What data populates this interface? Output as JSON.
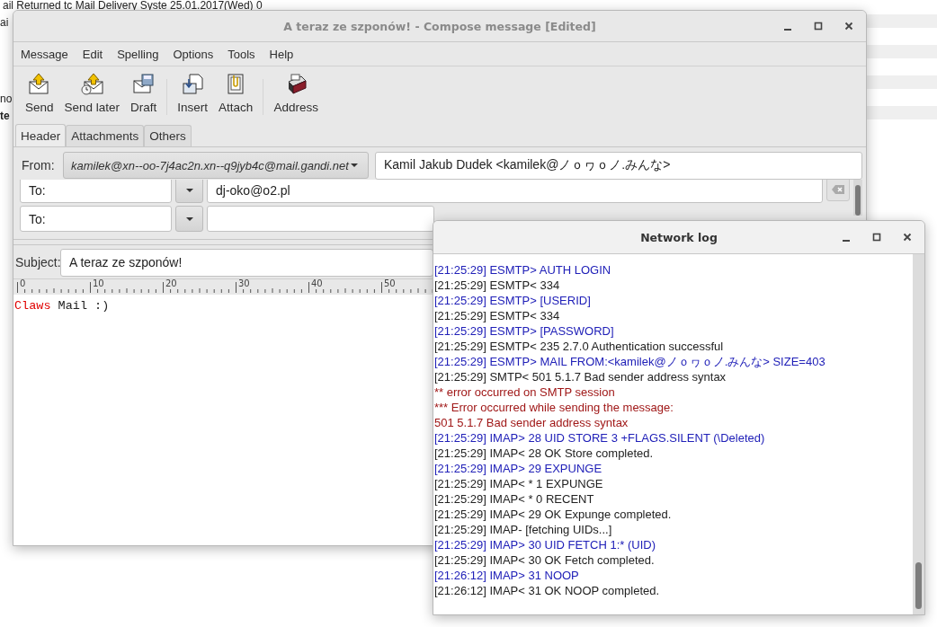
{
  "background_window": {
    "rows": [
      {
        "text": "ail Returned tc Mail Delivery Syste 25.01.2017(Wed) 0",
        "bold": false
      },
      {
        "text": "ai",
        "bold": false
      },
      {
        "text": "no",
        "bold": false
      },
      {
        "text": "te",
        "bold": true
      }
    ]
  },
  "compose_window": {
    "title": "A teraz ze szponów! - Compose message [Edited]",
    "menu": [
      "Message",
      "Edit",
      "Spelling",
      "Options",
      "Tools",
      "Help"
    ],
    "toolbar": [
      [
        {
          "label": "Send",
          "kind": "send"
        },
        {
          "label": "Send later",
          "kind": "send_later"
        },
        {
          "label": "Draft",
          "kind": "draft"
        }
      ],
      [
        {
          "label": "Insert",
          "kind": "insert"
        },
        {
          "label": "Attach",
          "kind": "attach"
        }
      ],
      [
        {
          "label": "Address",
          "kind": "address"
        }
      ]
    ],
    "tabs": [
      {
        "label": "Header",
        "selected": true
      },
      {
        "label": "Attachments",
        "selected": false
      },
      {
        "label": "Others",
        "selected": false
      }
    ],
    "from": {
      "label": "From:",
      "account": "kamilek@xn--oo-7j4ac2n.xn--q9jyb4c@mail.gandi.net",
      "name": "Kamil Jakub Dudek <kamilek@ノｏヮｏノ.みんな>"
    },
    "recipients": [
      {
        "type": "To:",
        "address": "dj-oko@o2.pl"
      },
      {
        "type": "To:"
      }
    ],
    "subject": {
      "label": "Subject:",
      "value": "A teraz ze szponów!"
    },
    "ruler": [
      "0",
      "10",
      "20",
      "30",
      "40",
      "50"
    ],
    "body": [
      {
        "text": "Claws",
        "kind": "highlight"
      },
      {
        "text": " Mail :)",
        "kind": "plain"
      }
    ]
  },
  "network_log": {
    "title": "Network log",
    "lines": [
      {
        "text": "[21:25:29] ESMTP> AUTH LOGIN",
        "kind": "out"
      },
      {
        "text": "[21:25:29] ESMTP< 334",
        "kind": "in"
      },
      {
        "text": "[21:25:29] ESMTP> [USERID]",
        "kind": "out"
      },
      {
        "text": "[21:25:29] ESMTP< 334",
        "kind": "in"
      },
      {
        "text": "[21:25:29] ESMTP> [PASSWORD]",
        "kind": "out"
      },
      {
        "text": "[21:25:29] ESMTP< 235 2.7.0 Authentication successful",
        "kind": "in"
      },
      {
        "text": "[21:25:29] ESMTP> MAIL FROM:<kamilek@ノｏヮｏノ.みんな> SIZE=403",
        "kind": "out"
      },
      {
        "text": "[21:25:29] SMTP< 501 5.1.7 Bad sender address syntax",
        "kind": "in"
      },
      {
        "text": "** error occurred on SMTP session",
        "kind": "error"
      },
      {
        "text": "*** Error occurred while sending the message:",
        "kind": "error"
      },
      {
        "text": "501 5.1.7 Bad sender address syntax",
        "kind": "error"
      },
      {
        "text": "[21:25:29] IMAP> 28 UID STORE 3 +FLAGS.SILENT (\\Deleted)",
        "kind": "out"
      },
      {
        "text": "[21:25:29] IMAP< 28 OK Store completed.",
        "kind": "in"
      },
      {
        "text": "[21:25:29] IMAP> 29 EXPUNGE",
        "kind": "out"
      },
      {
        "text": "[21:25:29] IMAP< * 1 EXPUNGE",
        "kind": "in"
      },
      {
        "text": "[21:25:29] IMAP< * 0 RECENT",
        "kind": "in"
      },
      {
        "text": "[21:25:29] IMAP< 29 OK Expunge completed.",
        "kind": "in"
      },
      {
        "text": "[21:25:29] IMAP- [fetching UIDs...]",
        "kind": "in"
      },
      {
        "text": "[21:25:29] IMAP> 30 UID FETCH 1:* (UID)",
        "kind": "out"
      },
      {
        "text": "[21:25:29] IMAP< 30 OK Fetch completed.",
        "kind": "in"
      },
      {
        "text": "[21:26:12] IMAP> 31 NOOP",
        "kind": "out"
      },
      {
        "text": "[21:26:12] IMAP< 31 OK NOOP completed.",
        "kind": "in"
      }
    ]
  }
}
